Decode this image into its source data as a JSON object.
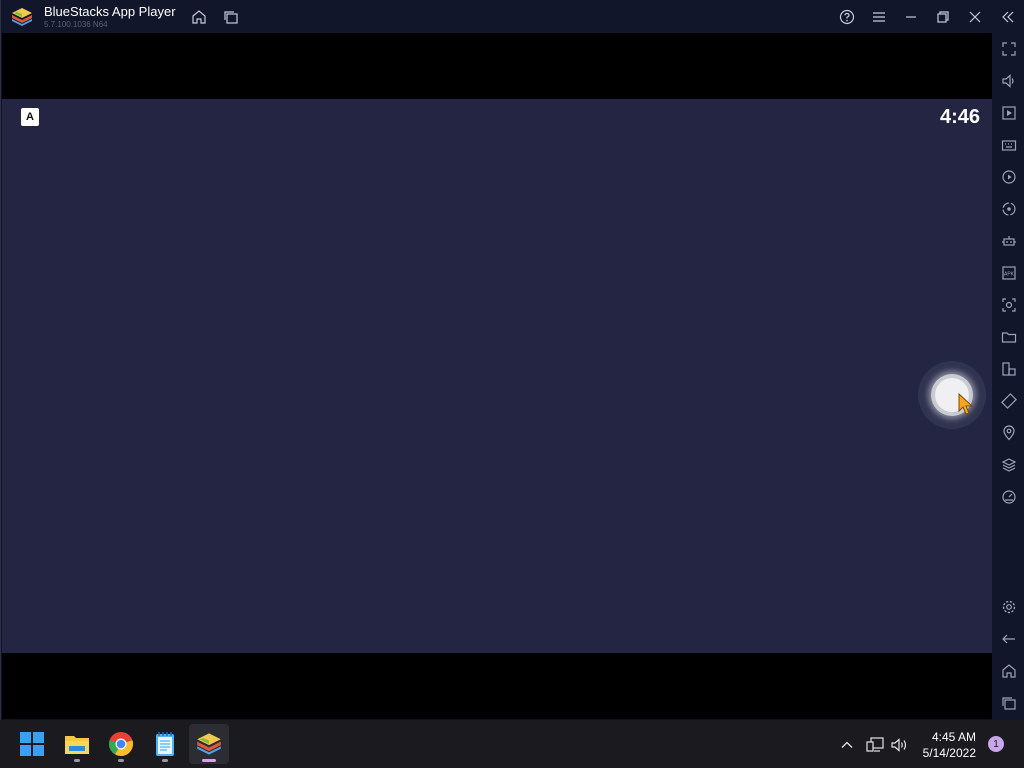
{
  "window": {
    "title": "BlueStacks App Player",
    "version": "5.7.100.1036 N64"
  },
  "titlebar_buttons": [
    "home-icon",
    "multi-instance-icon",
    "help-icon",
    "menu-icon",
    "minimize-icon",
    "restore-icon",
    "close-icon",
    "collapse-sidebar-icon"
  ],
  "android": {
    "status_icon_letter": "A",
    "clock": "4:46"
  },
  "sidebar": {
    "items": [
      "fullscreen-icon",
      "volume-icon",
      "media-icon",
      "keyboard-icon",
      "macro-icon",
      "sync-icon",
      "robot-icon",
      "apk-icon",
      "screenshot-icon",
      "folder-icon",
      "multi-instance-icon",
      "rotate-icon",
      "location-icon",
      "layers-icon",
      "eco-mode-icon",
      "settings-icon",
      "back-icon",
      "home-icon",
      "recents-icon"
    ]
  },
  "taskbar": {
    "apps": [
      "windows-start-icon",
      "file-explorer-icon",
      "chrome-icon",
      "notepad-icon",
      "bluestacks-icon"
    ],
    "time": "4:45 AM",
    "date": "5/14/2022",
    "notification_count": "1"
  },
  "colors": {
    "titlebar": "#12162b",
    "android_bg": "#232542",
    "taskbar": "#1a1a1f"
  }
}
